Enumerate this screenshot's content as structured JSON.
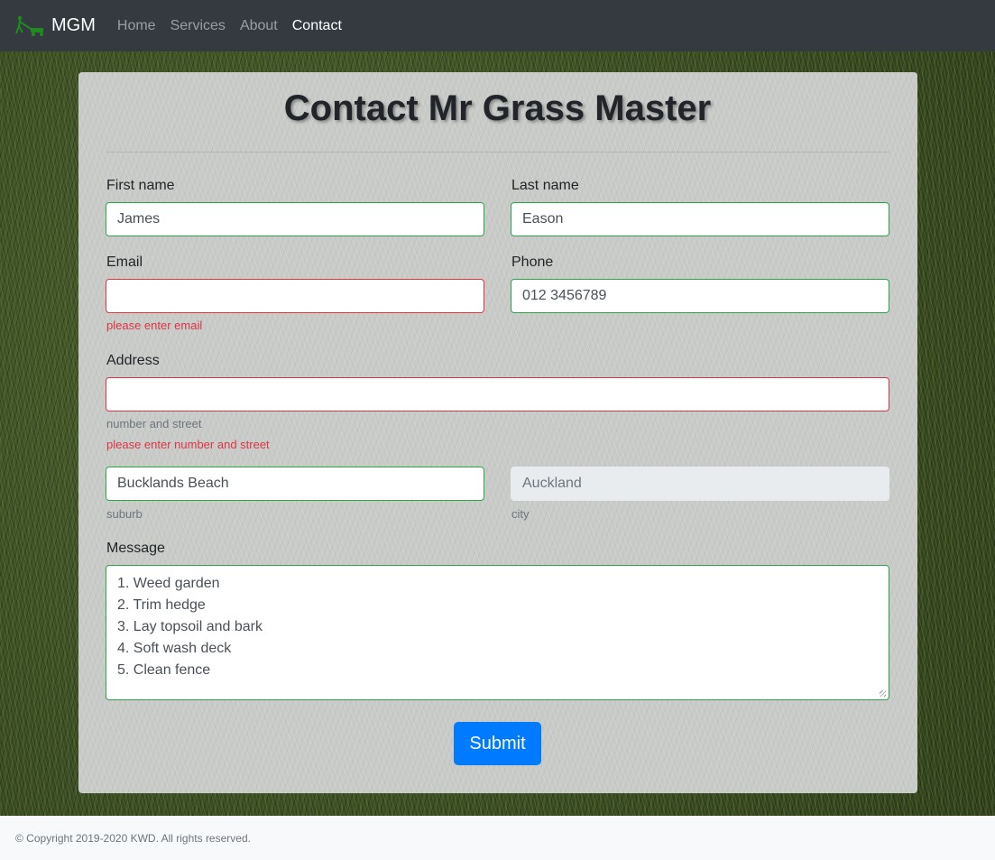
{
  "nav": {
    "brand": "MGM",
    "brand_icon": "lawnmower-icon",
    "links": [
      {
        "label": "Home",
        "active": false
      },
      {
        "label": "Services",
        "active": false
      },
      {
        "label": "About",
        "active": false
      },
      {
        "label": "Contact",
        "active": true
      }
    ]
  },
  "form": {
    "title": "Contact Mr Grass Master",
    "first_name": {
      "label": "First name",
      "value": "James"
    },
    "last_name": {
      "label": "Last name",
      "value": "Eason"
    },
    "email": {
      "label": "Email",
      "value": "",
      "error": "please enter email"
    },
    "phone": {
      "label": "Phone",
      "value": "012 3456789"
    },
    "address": {
      "label": "Address",
      "value": "",
      "help": "number and street",
      "error": "please enter number and street"
    },
    "suburb": {
      "value": "Bucklands Beach",
      "help": "suburb"
    },
    "city": {
      "value": "Auckland",
      "help": "city"
    },
    "message": {
      "label": "Message",
      "lines": [
        "1. Weed garden",
        "2. Trim hedge",
        "3. Lay topsoil and bark",
        "4. Soft wash deck",
        "5. Clean fence"
      ]
    },
    "submit_label": "Submit"
  },
  "footer": {
    "text": "© Copyright 2019-2020 KWD. All rights reserved."
  },
  "colors": {
    "navbar": "#343a40",
    "valid": "#28a745",
    "invalid": "#dc3545",
    "primary": "#007bff",
    "brand_icon": "#1e8c1e"
  }
}
